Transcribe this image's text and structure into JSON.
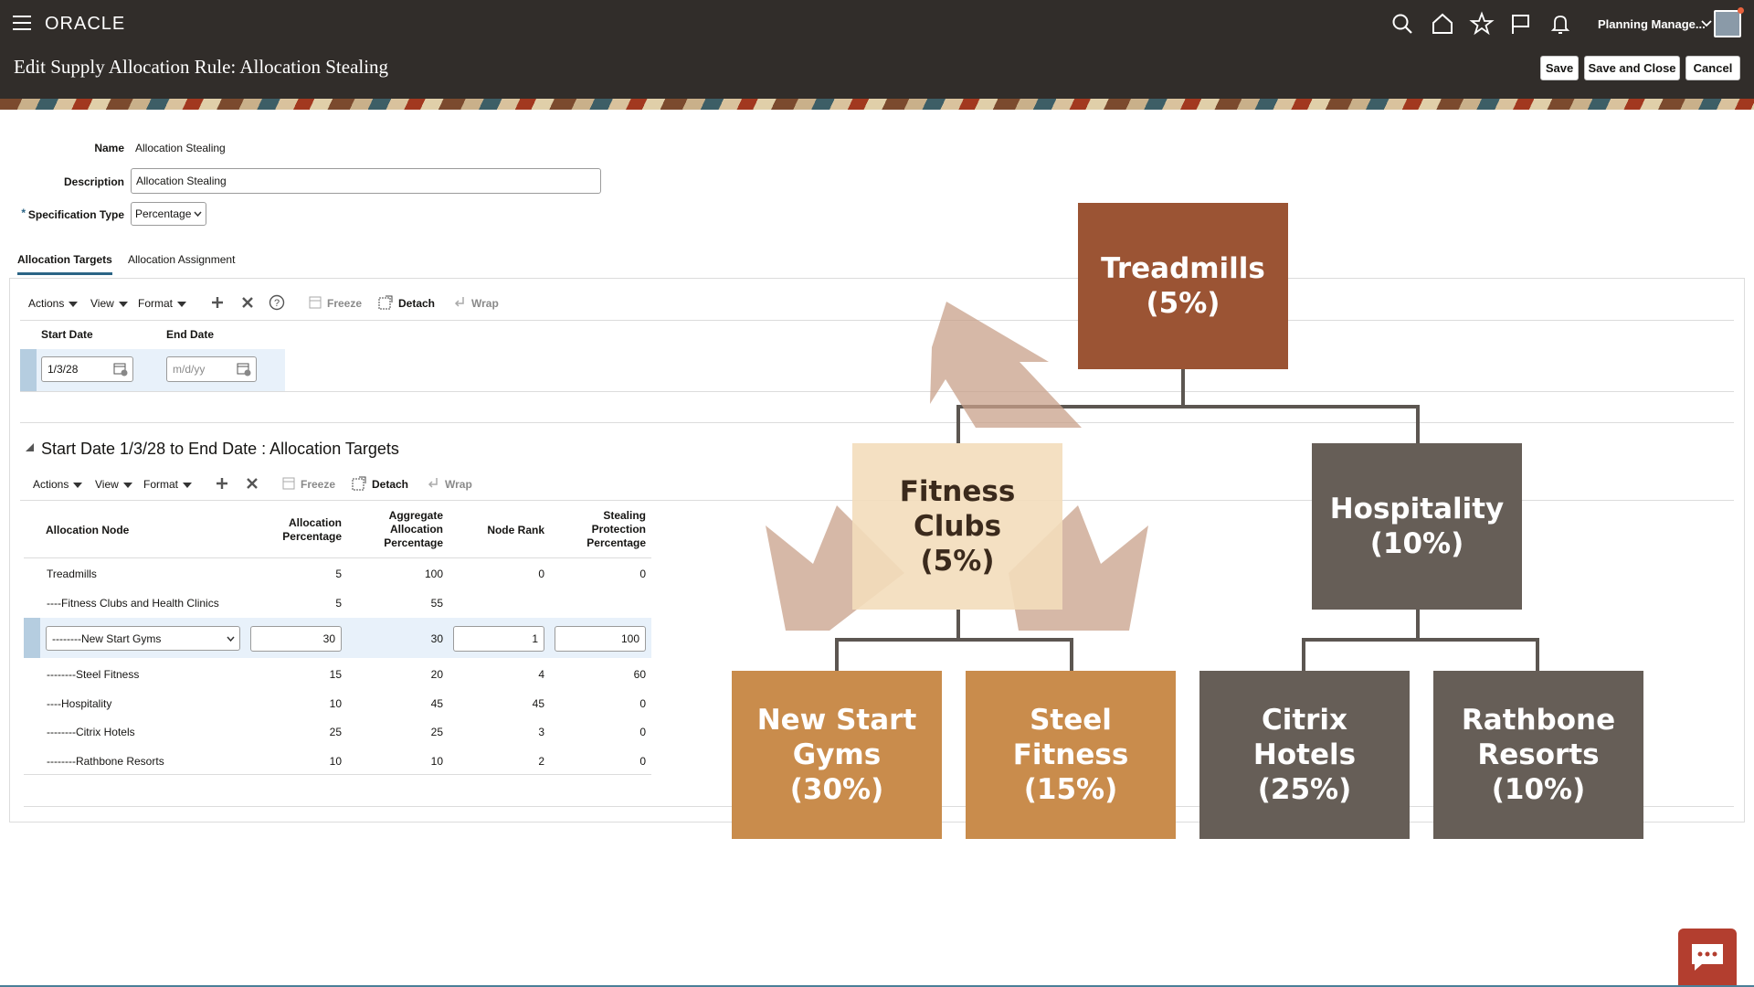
{
  "header": {
    "logo": "ORACLE",
    "page_title": "Edit Supply Allocation Rule: Allocation Stealing",
    "user_label": "Planning Manage...",
    "save_label": "Save",
    "save_close_label": "Save and Close",
    "cancel_label": "Cancel"
  },
  "form": {
    "name_label": "Name",
    "name_value": "Allocation Stealing",
    "description_label": "Description",
    "description_value": "Allocation Stealing",
    "spec_type_required": "*",
    "spec_type_label": "Specification Type",
    "spec_type_value": "Percentage"
  },
  "tabs": [
    {
      "label": "Allocation Targets",
      "active": true
    },
    {
      "label": "Allocation Assignment",
      "active": false
    }
  ],
  "toolbar1": {
    "actions": "Actions",
    "view": "View",
    "format": "Format",
    "freeze": "Freeze",
    "detach": "Detach",
    "wrap": "Wrap"
  },
  "dates_table": {
    "headers": [
      "Start Date",
      "End Date"
    ],
    "start_date": "1/3/28",
    "end_date_placeholder": "m/d/yy"
  },
  "section": {
    "title": "Start Date 1/3/28 to End Date : Allocation Targets"
  },
  "toolbar2": {
    "actions": "Actions",
    "view": "View",
    "format": "Format",
    "freeze": "Freeze",
    "detach": "Detach",
    "wrap": "Wrap"
  },
  "targets_table": {
    "headers": [
      "Allocation Node",
      "Allocation Percentage",
      "Aggregate Allocation Percentage",
      "Node Rank",
      "Stealing Protection Percentage"
    ],
    "rows": [
      {
        "node": "Treadmills",
        "alloc": "5",
        "aggregate": "100",
        "rank": "0",
        "stealing": "0"
      },
      {
        "node": "----Fitness Clubs and Health Clinics",
        "alloc": "5",
        "aggregate": "55",
        "rank": "",
        "stealing": ""
      },
      {
        "node": "--------New Start Gyms",
        "alloc": "30",
        "aggregate": "30",
        "rank": "1",
        "stealing": "100"
      },
      {
        "node": "--------Steel Fitness",
        "alloc": "15",
        "aggregate": "20",
        "rank": "4",
        "stealing": "60"
      },
      {
        "node": "----Hospitality",
        "alloc": "10",
        "aggregate": "45",
        "rank": "45",
        "stealing": "0"
      },
      {
        "node": "--------Citrix Hotels",
        "alloc": "25",
        "aggregate": "25",
        "rank": "3",
        "stealing": "0"
      },
      {
        "node": "--------Rathbone Resorts",
        "alloc": "10",
        "aggregate": "10",
        "rank": "2",
        "stealing": "0"
      }
    ]
  },
  "diagram": {
    "root": {
      "name": "Treadmills",
      "pct": "(5%)"
    },
    "fitness": {
      "name1": "Fitness",
      "name2": "Clubs",
      "pct": "(5%)"
    },
    "hospitality": {
      "name": "Hospitality",
      "pct": "(10%)"
    },
    "new_start": {
      "name1": "New Start",
      "name2": "Gyms",
      "pct": "(30%)"
    },
    "steel": {
      "name1": "Steel",
      "name2": "Fitness",
      "pct": "(15%)"
    },
    "citrix": {
      "name1": "Citrix",
      "name2": "Hotels",
      "pct": "(25%)"
    },
    "rathbone": {
      "name1": "Rathbone",
      "name2": "Resorts",
      "pct": "(10%)"
    },
    "colors": {
      "root": "#9b5434",
      "fitness": "#f3ddbb",
      "gray": "#665e57",
      "orange": "#c98c4c",
      "arrow": "#c8a08a"
    }
  }
}
